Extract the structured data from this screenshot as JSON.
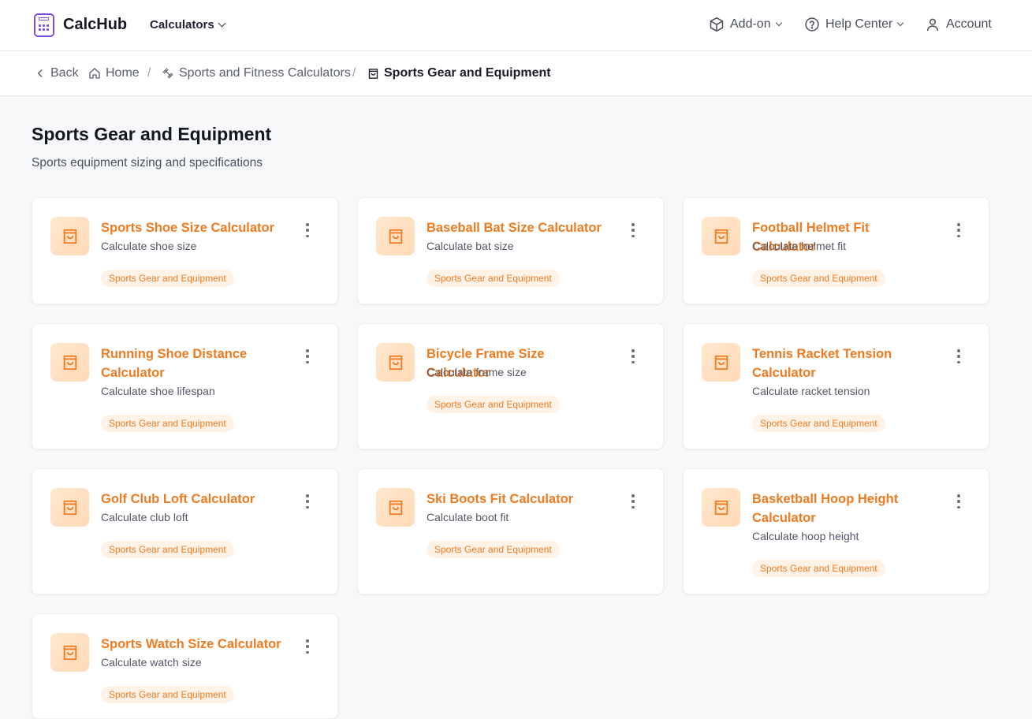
{
  "nav": {
    "brand": "CalcHub",
    "calculators": "Calculators",
    "addon": "Add-on",
    "help": "Help Center",
    "account": "Account"
  },
  "breadcrumb": {
    "back": "Back",
    "home": "Home",
    "parent": "Sports and Fitness Calculators",
    "current": "Sports Gear and Equipment"
  },
  "page": {
    "title": "Sports Gear and Equipment",
    "subtitle": "Sports equipment sizing and specifications"
  },
  "cards": [
    {
      "title": "Sports Shoe Size Calculator",
      "desc": "Calculate shoe size",
      "tag": "Sports Gear and Equipment"
    },
    {
      "title": "Baseball Bat Size Calculator",
      "desc": "Calculate bat size",
      "tag": "Sports Gear and Equipment"
    },
    {
      "title": "Football Helmet Fit Calculator",
      "desc": "Calculate helmet fit",
      "tag": "Sports Gear and Equipment"
    },
    {
      "title": "Running Shoe Distance Calculator",
      "desc": "Calculate shoe lifespan",
      "tag": "Sports Gear and Equipment"
    },
    {
      "title": "Bicycle Frame Size Calculator",
      "desc": "Calculate frame size",
      "tag": "Sports Gear and Equipment"
    },
    {
      "title": "Tennis Racket Tension Calculator",
      "desc": "Calculate racket tension",
      "tag": "Sports Gear and Equipment"
    },
    {
      "title": "Golf Club Loft Calculator",
      "desc": "Calculate club loft",
      "tag": "Sports Gear and Equipment"
    },
    {
      "title": "Ski Boots Fit Calculator",
      "desc": "Calculate boot fit",
      "tag": "Sports Gear and Equipment"
    },
    {
      "title": "Basketball Hoop Height Calculator",
      "desc": "Calculate hoop height",
      "tag": "Sports Gear and Equipment"
    },
    {
      "title": "Sports Watch Size Calculator",
      "desc": "Calculate watch size",
      "tag": "Sports Gear and Equipment"
    }
  ],
  "colors": {
    "accent": "#f07a1f",
    "brand": "#7c4ddb",
    "tag_bg": "#fff2e6"
  },
  "icons": {
    "logo": "calculator-icon",
    "card": "shopping-bag-icon",
    "menu": "more-vertical-icon"
  }
}
